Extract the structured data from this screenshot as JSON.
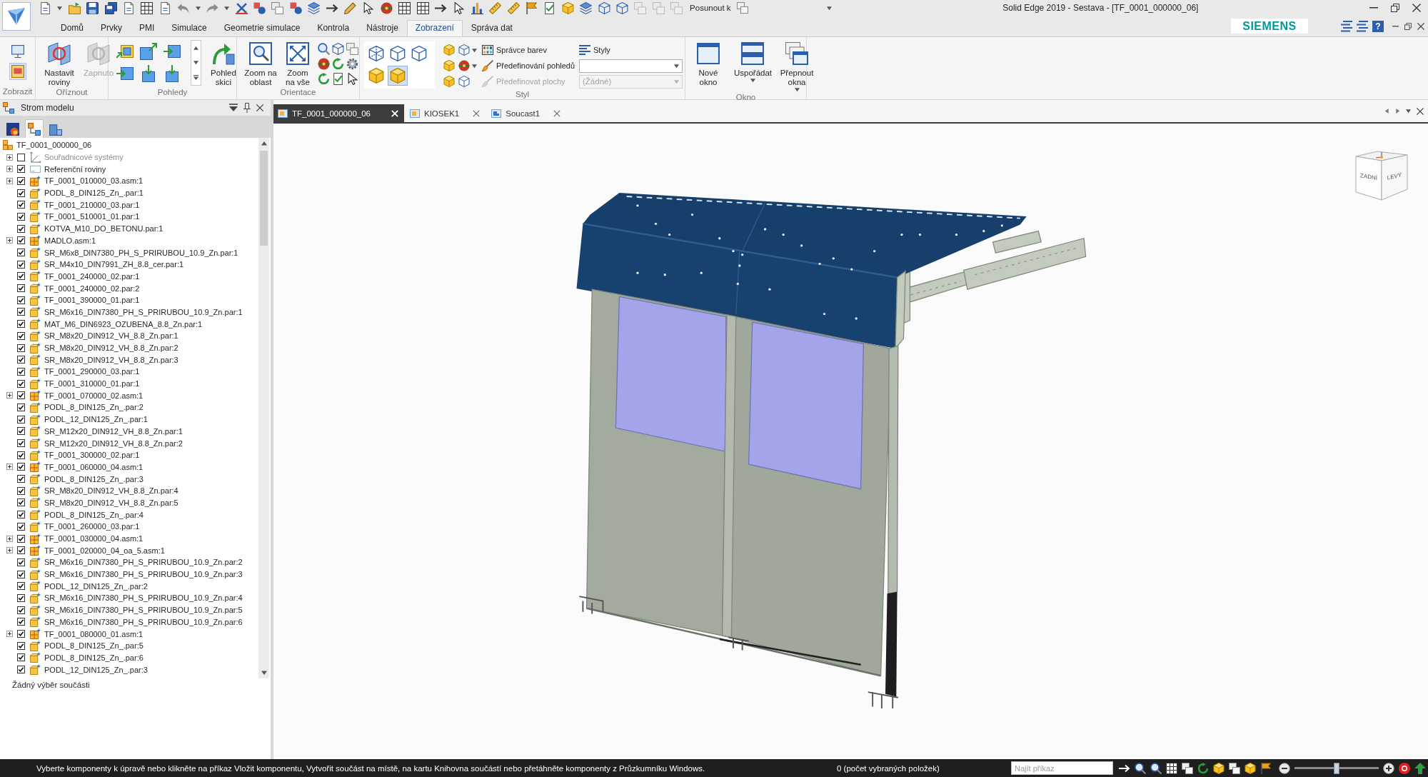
{
  "title_bar": {
    "move_to_label": "Posunout k",
    "title": "Solid Edge 2019 - Sestava - [TF_0001_000000_06]",
    "help": "?"
  },
  "ribbon_tabs": [
    {
      "label": "Domů",
      "selected": false
    },
    {
      "label": "Prvky",
      "selected": false
    },
    {
      "label": "PMI",
      "selected": false
    },
    {
      "label": "Simulace",
      "selected": false
    },
    {
      "label": "Geometrie simulace",
      "selected": false
    },
    {
      "label": "Kontrola",
      "selected": false
    },
    {
      "label": "Nástroje",
      "selected": false
    },
    {
      "label": "Zobrazení",
      "selected": true
    },
    {
      "label": "Správa dat",
      "selected": false
    }
  ],
  "brand": "SIEMENS",
  "ribbon": {
    "groups": [
      {
        "kind": "display",
        "label": "Zobrazit",
        "toggles": [
          {
            "selected": false
          },
          {
            "selected": true
          }
        ]
      },
      {
        "kind": "clipping",
        "label": "Oříznout",
        "buttons": [
          {
            "label": "Nastavit roviny",
            "disabled": false
          },
          {
            "label": "Zapnuto",
            "disabled": true
          }
        ]
      },
      {
        "kind": "views",
        "label": "Pohledy",
        "buttons": [
          {
            "label": "Pohled skici",
            "disabled": false
          }
        ]
      },
      {
        "kind": "orientation",
        "label": "Orientace",
        "buttons": [
          {
            "label": "Zoom na oblast",
            "disabled": false
          },
          {
            "label": "Zoom na vše",
            "disabled": false
          }
        ]
      },
      {
        "kind": "render_modes",
        "modes": [
          {
            "selected": false
          },
          {
            "selected": false
          },
          {
            "selected": false
          },
          {
            "selected": false
          },
          {
            "selected": true
          }
        ]
      },
      {
        "kind": "style",
        "label": "Styl",
        "buttons": [
          {
            "label": "Správce barev",
            "disabled": false
          },
          {
            "label": "Předefinování pohledů",
            "disabled": false
          },
          {
            "label": "Předefinovat plochy",
            "disabled": true
          }
        ],
        "styles_button": "Styly",
        "dropdowns": [
          {
            "disabled": false
          },
          {
            "value": "(Žádné)",
            "disabled": true
          }
        ]
      },
      {
        "kind": "window",
        "label": "Okno",
        "buttons": [
          {
            "label": "Nové okno",
            "has_menu": false
          },
          {
            "label": "Uspořádat",
            "has_menu": true
          },
          {
            "label": "Přepnout okna",
            "has_menu": true
          }
        ]
      }
    ]
  },
  "model_tree": {
    "title": "Strom modelu",
    "tabs": [
      {
        "selected": false
      },
      {
        "selected": true
      },
      {
        "selected": false
      }
    ],
    "root": {
      "label": "TF_0001_000000_06",
      "kind": "root",
      "children": [
        {
          "label": "Souřadnicové systémy",
          "kind": "coordinate_systems",
          "checked": false,
          "expanded": false
        },
        {
          "label": "Referenční roviny",
          "kind": "reference_planes",
          "checked": true,
          "expanded": false
        },
        {
          "label": "TF_0001_010000_03.asm:1",
          "kind": "assembly",
          "checked": true,
          "expanded": false
        },
        {
          "label": "PODL_8_DIN125_Zn_.par:1",
          "kind": "part",
          "checked": true
        },
        {
          "label": "TF_0001_210000_03.par:1",
          "kind": "part",
          "checked": true
        },
        {
          "label": "TF_0001_510001_01.par:1",
          "kind": "part",
          "checked": true
        },
        {
          "label": "KOTVA_M10_DO_BETONU.par:1",
          "kind": "part",
          "checked": true
        },
        {
          "label": "MADLO.asm:1",
          "kind": "assembly",
          "checked": true,
          "expanded": false
        },
        {
          "label": "SR_M6x8_DIN7380_PH_S_PRIRUBOU_10.9_Zn.par:1",
          "kind": "part",
          "checked": true
        },
        {
          "label": "SR_M4x10_DIN7991_ZH_8.8_cer.par:1",
          "kind": "part",
          "checked": true
        },
        {
          "label": "TF_0001_240000_02.par:1",
          "kind": "part",
          "checked": true
        },
        {
          "label": "TF_0001_240000_02.par:2",
          "kind": "part",
          "checked": true
        },
        {
          "label": "TF_0001_390000_01.par:1",
          "kind": "part",
          "checked": true
        },
        {
          "label": "SR_M6x16_DIN7380_PH_S_PRIRUBOU_10.9_Zn.par:1",
          "kind": "part",
          "checked": true
        },
        {
          "label": "MAT_M6_DIN6923_OZUBENA_8.8_Zn.par:1",
          "kind": "part",
          "checked": true
        },
        {
          "label": "SR_M8x20_DIN912_VH_8.8_Zn.par:1",
          "kind": "part",
          "checked": true
        },
        {
          "label": "SR_M8x20_DIN912_VH_8.8_Zn.par:2",
          "kind": "part",
          "checked": true
        },
        {
          "label": "SR_M8x20_DIN912_VH_8.8_Zn.par:3",
          "kind": "part",
          "checked": true
        },
        {
          "label": "TF_0001_290000_03.par:1",
          "kind": "part",
          "checked": true
        },
        {
          "label": "TF_0001_310000_01.par:1",
          "kind": "part",
          "checked": true
        },
        {
          "label": "TF_0001_070000_02.asm:1",
          "kind": "assembly",
          "checked": true,
          "expanded": false
        },
        {
          "label": "PODL_8_DIN125_Zn_.par:2",
          "kind": "part",
          "checked": true
        },
        {
          "label": "PODL_12_DIN125_Zn_.par:1",
          "kind": "part",
          "checked": true
        },
        {
          "label": "SR_M12x20_DIN912_VH_8.8_Zn.par:1",
          "kind": "part",
          "checked": true
        },
        {
          "label": "SR_M12x20_DIN912_VH_8.8_Zn.par:2",
          "kind": "part",
          "checked": true
        },
        {
          "label": "TF_0001_300000_02.par:1",
          "kind": "part",
          "checked": true
        },
        {
          "label": "TF_0001_060000_04.asm:1",
          "kind": "assembly",
          "checked": true,
          "expanded": false
        },
        {
          "label": "PODL_8_DIN125_Zn_.par:3",
          "kind": "part",
          "checked": true
        },
        {
          "label": "SR_M8x20_DIN912_VH_8.8_Zn.par:4",
          "kind": "part",
          "checked": true
        },
        {
          "label": "SR_M8x20_DIN912_VH_8.8_Zn.par:5",
          "kind": "part",
          "checked": true
        },
        {
          "label": "PODL_8_DIN125_Zn_.par:4",
          "kind": "part",
          "checked": true
        },
        {
          "label": "TF_0001_260000_03.par:1",
          "kind": "part",
          "checked": true
        },
        {
          "label": "TF_0001_030000_04.asm:1",
          "kind": "assembly",
          "checked": true,
          "expanded": false
        },
        {
          "label": "TF_0001_020000_04_oa_5.asm:1",
          "kind": "assembly",
          "checked": true,
          "expanded": false
        },
        {
          "label": "SR_M6x16_DIN7380_PH_S_PRIRUBOU_10.9_Zn.par:2",
          "kind": "part",
          "checked": true
        },
        {
          "label": "SR_M6x16_DIN7380_PH_S_PRIRUBOU_10.9_Zn.par:3",
          "kind": "part",
          "checked": true
        },
        {
          "label": "PODL_12_DIN125_Zn_.par:2",
          "kind": "part",
          "checked": true
        },
        {
          "label": "SR_M6x16_DIN7380_PH_S_PRIRUBOU_10.9_Zn.par:4",
          "kind": "part",
          "checked": true
        },
        {
          "label": "SR_M6x16_DIN7380_PH_S_PRIRUBOU_10.9_Zn.par:5",
          "kind": "part",
          "checked": true
        },
        {
          "label": "SR_M6x16_DIN7380_PH_S_PRIRUBOU_10.9_Zn.par:6",
          "kind": "part",
          "checked": true
        },
        {
          "label": "TF_0001_080000_01.asm:1",
          "kind": "assembly",
          "checked": true,
          "expanded": false
        },
        {
          "label": "PODL_8_DIN125_Zn_.par:5",
          "kind": "part",
          "checked": true
        },
        {
          "label": "PODL_8_DIN125_Zn_.par:6",
          "kind": "part",
          "checked": true
        },
        {
          "label": "PODL_12_DIN125_Zn_.par:3",
          "kind": "part",
          "checked": true
        }
      ]
    },
    "selection_info": "Žádný výběr součásti"
  },
  "document_tabs": [
    {
      "label": "TF_0001_000000_06",
      "selected": true
    },
    {
      "label": "KIOSEK1",
      "selected": false
    },
    {
      "label": "Soucast1",
      "selected": false
    }
  ],
  "view_cube": {
    "faces": [
      "ZADNÍ",
      "LEVÝ"
    ]
  },
  "status_bar": {
    "prompt": "Vyberte komponenty k úpravě nebo klikněte na příkaz Vložit komponentu, Vytvořit součást na místě, na kartu Knihovna součástí nebo přetáhněte komponenty z Průzkumníku Windows.",
    "selection_count": "0 (počet vybraných položek)",
    "command_search": {
      "placeholder": "Najít příkaz"
    },
    "zoom_slider": {
      "level": 0.5
    }
  }
}
